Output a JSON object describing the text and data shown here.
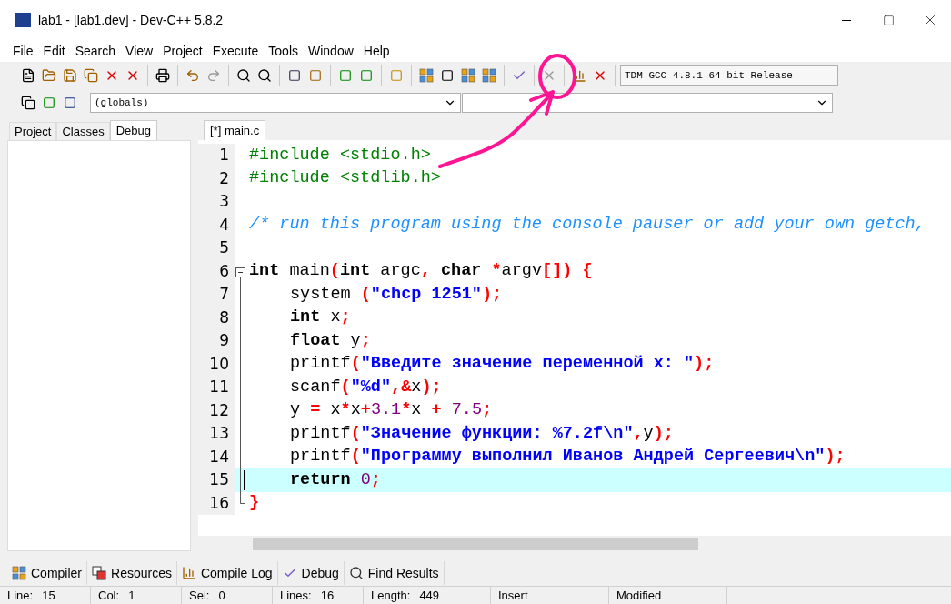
{
  "window": {
    "title": "lab1 - [lab1.dev] - Dev-C++ 5.8.2"
  },
  "menu": [
    "File",
    "Edit",
    "Search",
    "View",
    "Project",
    "Execute",
    "Tools",
    "Window",
    "Help"
  ],
  "compiler_select": {
    "value": "TDM-GCC 4.8.1 64-bit Release"
  },
  "scope_select": {
    "value": "(globals)"
  },
  "side_tabs": [
    {
      "label": "Project",
      "selected": false
    },
    {
      "label": "Classes",
      "selected": false
    },
    {
      "label": "Debug",
      "selected": true
    }
  ],
  "editor_tabs": [
    {
      "label": "[*] main.c",
      "selected": true
    }
  ],
  "code": [
    {
      "number": "1",
      "kind": "plain",
      "indent": false,
      "current": false,
      "tokens": [
        {
          "kind": "preproc",
          "text": "#include <stdio.h>"
        }
      ]
    },
    {
      "number": "2",
      "kind": "plain",
      "indent": false,
      "current": false,
      "tokens": [
        {
          "kind": "preproc",
          "text": "#include <stdlib.h>"
        }
      ]
    },
    {
      "number": "3",
      "kind": "plain",
      "current": false
    },
    {
      "number": "4",
      "kind": "plain",
      "indent": false,
      "current": false,
      "tokens": [
        {
          "kind": "comment",
          "text": "/* run this program using the console pauser or add your own getch,"
        }
      ]
    },
    {
      "number": "5",
      "kind": "plain",
      "current": false
    },
    {
      "number": "6",
      "kind": "fold_start",
      "indent": false,
      "current": false,
      "tokens": [
        {
          "kind": "keyword",
          "text": "int"
        },
        {
          "kind": "plain",
          "text": " main"
        },
        {
          "kind": "symbol",
          "text": "("
        },
        {
          "kind": "keyword",
          "text": "int"
        },
        {
          "kind": "plain",
          "text": " argc"
        },
        {
          "kind": "symbol",
          "text": ","
        },
        {
          "kind": "keyword",
          "text": " char"
        },
        {
          "kind": "symbol",
          "text": " *"
        },
        {
          "kind": "plain",
          "text": "argv"
        },
        {
          "kind": "symbol",
          "text": "[])"
        },
        {
          "kind": "symbol",
          "text": " {"
        }
      ]
    },
    {
      "number": "7",
      "kind": "fold_body",
      "indent": true,
      "current": false,
      "tokens": [
        {
          "kind": "plain",
          "text": "system "
        },
        {
          "kind": "symbol",
          "text": "("
        },
        {
          "kind": "string",
          "text": "\"chcp 1251\""
        },
        {
          "kind": "symbol",
          "text": ");"
        }
      ]
    },
    {
      "number": "8",
      "kind": "fold_body",
      "indent": true,
      "current": false,
      "tokens": [
        {
          "kind": "keyword",
          "text": "int"
        },
        {
          "kind": "plain",
          "text": " x"
        },
        {
          "kind": "symbol",
          "text": ";"
        }
      ]
    },
    {
      "number": "9",
      "kind": "fold_body",
      "indent": true,
      "current": false,
      "tokens": [
        {
          "kind": "keyword",
          "text": "float"
        },
        {
          "kind": "plain",
          "text": " y"
        },
        {
          "kind": "symbol",
          "text": ";"
        }
      ]
    },
    {
      "number": "10",
      "kind": "fold_body",
      "indent": true,
      "current": false,
      "tokens": [
        {
          "kind": "plain",
          "text": "printf"
        },
        {
          "kind": "symbol",
          "text": "("
        },
        {
          "kind": "string",
          "text": "\"Введите значение переменной x: \""
        },
        {
          "kind": "symbol",
          "text": ");"
        }
      ]
    },
    {
      "number": "11",
      "kind": "fold_body",
      "indent": true,
      "current": false,
      "tokens": [
        {
          "kind": "plain",
          "text": "scanf"
        },
        {
          "kind": "symbol",
          "text": "("
        },
        {
          "kind": "string",
          "text": "\"%d\""
        },
        {
          "kind": "symbol",
          "text": ",&"
        },
        {
          "kind": "plain",
          "text": "x"
        },
        {
          "kind": "symbol",
          "text": ");"
        }
      ]
    },
    {
      "number": "12",
      "kind": "fold_body",
      "indent": true,
      "current": false,
      "tokens": [
        {
          "kind": "plain",
          "text": "y "
        },
        {
          "kind": "symbol",
          "text": "="
        },
        {
          "kind": "plain",
          "text": " x"
        },
        {
          "kind": "symbol",
          "text": "*"
        },
        {
          "kind": "plain",
          "text": "x"
        },
        {
          "kind": "symbol",
          "text": "+"
        },
        {
          "kind": "number",
          "text": "3.1"
        },
        {
          "kind": "symbol",
          "text": "*"
        },
        {
          "kind": "plain",
          "text": "x "
        },
        {
          "kind": "symbol",
          "text": "+"
        },
        {
          "kind": "number",
          "text": " 7.5"
        },
        {
          "kind": "symbol",
          "text": ";"
        }
      ]
    },
    {
      "number": "13",
      "kind": "fold_body",
      "indent": true,
      "current": false,
      "tokens": [
        {
          "kind": "plain",
          "text": "printf"
        },
        {
          "kind": "symbol",
          "text": "("
        },
        {
          "kind": "string",
          "text": "\"Значение функции: %7.2f\\n\""
        },
        {
          "kind": "symbol",
          "text": ","
        },
        {
          "kind": "plain",
          "text": "y"
        },
        {
          "kind": "symbol",
          "text": ");"
        }
      ]
    },
    {
      "number": "14",
      "kind": "fold_body",
      "indent": true,
      "current": false,
      "tokens": [
        {
          "kind": "plain",
          "text": "printf"
        },
        {
          "kind": "symbol",
          "text": "("
        },
        {
          "kind": "string",
          "text": "\"Программу выполнил Иванов Андрей Сергеевич\\n\""
        },
        {
          "kind": "symbol",
          "text": ");"
        }
      ]
    },
    {
      "number": "15",
      "kind": "fold_body",
      "indent": true,
      "current": true,
      "tokens": [
        {
          "kind": "keyword",
          "text": "return"
        },
        {
          "kind": "number",
          "text": " 0"
        },
        {
          "kind": "symbol",
          "text": ";"
        }
      ]
    },
    {
      "number": "16",
      "kind": "fold_end",
      "indent": false,
      "current": false,
      "tokens": [
        {
          "kind": "symbol",
          "text": "}"
        }
      ]
    }
  ],
  "bottom_tabs": [
    {
      "label": "Compiler"
    },
    {
      "label": "Resources"
    },
    {
      "label": "Compile Log"
    },
    {
      "label": "Debug"
    },
    {
      "label": "Find Results"
    }
  ],
  "status_bar": [
    {
      "label": "Line:",
      "value": "15"
    },
    {
      "label": "Col:",
      "value": "1"
    },
    {
      "label": "Sel:",
      "value": "0"
    },
    {
      "label": "Lines:",
      "value": "16"
    },
    {
      "label": "Length:",
      "value": "449"
    },
    {
      "value": "Insert"
    },
    {
      "value": "Modified"
    }
  ]
}
